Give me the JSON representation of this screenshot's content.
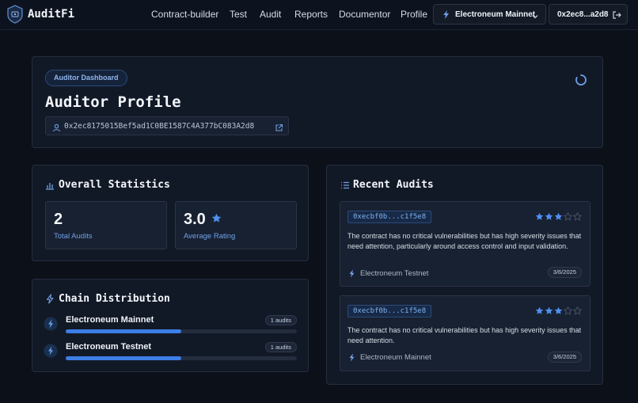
{
  "app": {
    "name": "AuditFi"
  },
  "nav": {
    "links": [
      "Contract-builder",
      "Test",
      "Audit",
      "Reports",
      "Documentor",
      "Profile"
    ],
    "network_label": "Electroneum Mainnet",
    "wallet_short": "0x2ec8...a2d8"
  },
  "profile": {
    "badge": "Auditor Dashboard",
    "title": "Auditor Profile",
    "address": "0x2ec8175015Bef5ad1C0BE1587C4A377bC083A2d8"
  },
  "stats": {
    "title": "Overall Statistics",
    "total_audits": "2",
    "total_audits_label": "Total Audits",
    "average_rating": "3.0",
    "average_rating_label": "Average Rating"
  },
  "chains": {
    "title": "Chain Distribution",
    "items": [
      {
        "name": "Electroneum Mainnet",
        "count": "1 audits",
        "share": 0.5
      },
      {
        "name": "Electroneum Testnet",
        "count": "1 audits",
        "share": 0.5
      }
    ]
  },
  "recent": {
    "title": "Recent Audits",
    "items": [
      {
        "hash": "0xecbf0b...c1f5e8",
        "rating": 3,
        "max_rating": 5,
        "summary": "The contract has no critical vulnerabilities but has high severity issues that need attention, particularly around access control and input validation.",
        "network": "Electroneum Testnet",
        "date": "3/6/2025"
      },
      {
        "hash": "0xecbf0b...c1f5e8",
        "rating": 3,
        "max_rating": 5,
        "summary": "The contract has no critical vulnerabilities but has high severity issues that need attention.",
        "network": "Electroneum Mainnet",
        "date": "3/6/2025"
      }
    ]
  },
  "colors": {
    "accent": "#3d7ee6",
    "background": "#0b1019",
    "card": "#121926"
  }
}
